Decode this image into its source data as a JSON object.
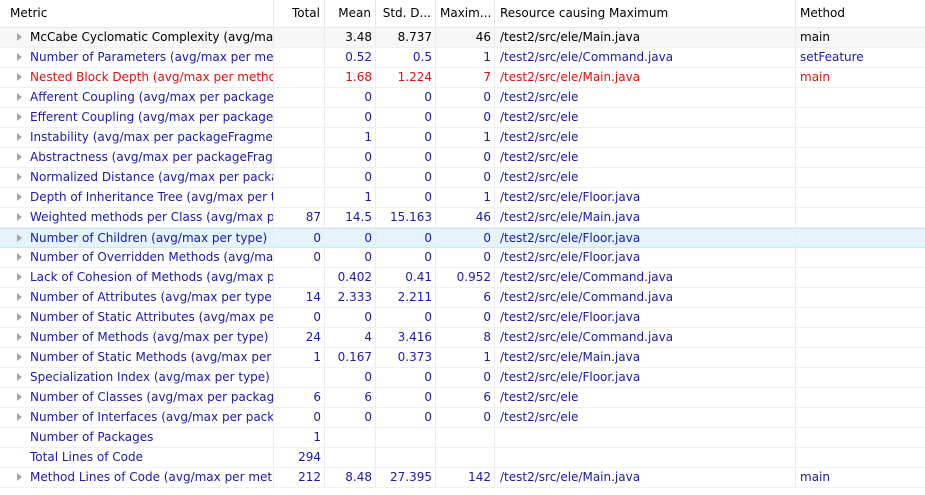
{
  "columns": [
    "Metric",
    "Total",
    "Mean",
    "Std. D...",
    "Maxim...",
    "Resource causing Maximum",
    "Method"
  ],
  "colors": {
    "normal": "#1a1aa6",
    "warning": "#e01010",
    "default": "#000000"
  },
  "rows": [
    {
      "metric": "McCabe Cyclomatic Complexity (avg/max",
      "total": "",
      "mean": "3.48",
      "std": "8.737",
      "max": "46",
      "resource": "/test2/src/ele/Main.java",
      "method": "main",
      "style": "black",
      "arrow": true
    },
    {
      "metric": "Number of Parameters (avg/max per meth",
      "total": "",
      "mean": "0.52",
      "std": "0.5",
      "max": "1",
      "resource": "/test2/src/ele/Command.java",
      "method": "setFeature",
      "style": "blue",
      "arrow": true
    },
    {
      "metric": "Nested Block Depth (avg/max per methoc",
      "total": "",
      "mean": "1.68",
      "std": "1.224",
      "max": "7",
      "resource": "/test2/src/ele/Main.java",
      "method": "main",
      "style": "red",
      "arrow": true
    },
    {
      "metric": "Afferent Coupling (avg/max per packageF",
      "total": "",
      "mean": "0",
      "std": "0",
      "max": "0",
      "resource": "/test2/src/ele",
      "method": "",
      "style": "blue",
      "arrow": true
    },
    {
      "metric": "Efferent Coupling (avg/max per packageFı",
      "total": "",
      "mean": "0",
      "std": "0",
      "max": "0",
      "resource": "/test2/src/ele",
      "method": "",
      "style": "blue",
      "arrow": true
    },
    {
      "metric": "Instability (avg/max per packageFragment",
      "total": "",
      "mean": "1",
      "std": "0",
      "max": "1",
      "resource": "/test2/src/ele",
      "method": "",
      "style": "blue",
      "arrow": true
    },
    {
      "metric": "Abstractness (avg/max per packageFragm",
      "total": "",
      "mean": "0",
      "std": "0",
      "max": "0",
      "resource": "/test2/src/ele",
      "method": "",
      "style": "blue",
      "arrow": true
    },
    {
      "metric": "Normalized Distance (avg/max per packag",
      "total": "",
      "mean": "0",
      "std": "0",
      "max": "0",
      "resource": "/test2/src/ele",
      "method": "",
      "style": "blue",
      "arrow": true
    },
    {
      "metric": "Depth of Inheritance Tree (avg/max per ty",
      "total": "",
      "mean": "1",
      "std": "0",
      "max": "1",
      "resource": "/test2/src/ele/Floor.java",
      "method": "",
      "style": "blue",
      "arrow": true
    },
    {
      "metric": "Weighted methods per Class (avg/max pe",
      "total": "87",
      "mean": "14.5",
      "std": "15.163",
      "max": "46",
      "resource": "/test2/src/ele/Main.java",
      "method": "",
      "style": "blue",
      "arrow": true
    },
    {
      "metric": "Number of Children (avg/max per type)",
      "total": "0",
      "mean": "0",
      "std": "0",
      "max": "0",
      "resource": "/test2/src/ele/Floor.java",
      "method": "",
      "style": "blue",
      "arrow": true,
      "selected": true
    },
    {
      "metric": "Number of Overridden Methods (avg/max",
      "total": "0",
      "mean": "0",
      "std": "0",
      "max": "0",
      "resource": "/test2/src/ele/Floor.java",
      "method": "",
      "style": "blue",
      "arrow": true
    },
    {
      "metric": "Lack of Cohesion of Methods (avg/max pe",
      "total": "",
      "mean": "0.402",
      "std": "0.41",
      "max": "0.952",
      "resource": "/test2/src/ele/Command.java",
      "method": "",
      "style": "blue",
      "arrow": true
    },
    {
      "metric": "Number of Attributes (avg/max per type)",
      "total": "14",
      "mean": "2.333",
      "std": "2.211",
      "max": "6",
      "resource": "/test2/src/ele/Command.java",
      "method": "",
      "style": "blue",
      "arrow": true
    },
    {
      "metric": "Number of Static Attributes (avg/max per",
      "total": "0",
      "mean": "0",
      "std": "0",
      "max": "0",
      "resource": "/test2/src/ele/Floor.java",
      "method": "",
      "style": "blue",
      "arrow": true
    },
    {
      "metric": "Number of Methods (avg/max per type)",
      "total": "24",
      "mean": "4",
      "std": "3.416",
      "max": "8",
      "resource": "/test2/src/ele/Command.java",
      "method": "",
      "style": "blue",
      "arrow": true
    },
    {
      "metric": "Number of Static Methods (avg/max per t",
      "total": "1",
      "mean": "0.167",
      "std": "0.373",
      "max": "1",
      "resource": "/test2/src/ele/Main.java",
      "method": "",
      "style": "blue",
      "arrow": true
    },
    {
      "metric": "Specialization Index (avg/max per type)",
      "total": "",
      "mean": "0",
      "std": "0",
      "max": "0",
      "resource": "/test2/src/ele/Floor.java",
      "method": "",
      "style": "blue",
      "arrow": true
    },
    {
      "metric": "Number of Classes (avg/max per package",
      "total": "6",
      "mean": "6",
      "std": "0",
      "max": "6",
      "resource": "/test2/src/ele",
      "method": "",
      "style": "blue",
      "arrow": true
    },
    {
      "metric": "Number of Interfaces (avg/max per packa",
      "total": "0",
      "mean": "0",
      "std": "0",
      "max": "0",
      "resource": "/test2/src/ele",
      "method": "",
      "style": "blue",
      "arrow": true
    },
    {
      "metric": "Number of Packages",
      "total": "1",
      "mean": "",
      "std": "",
      "max": "",
      "resource": "",
      "method": "",
      "style": "blue",
      "arrow": false
    },
    {
      "metric": "Total Lines of Code",
      "total": "294",
      "mean": "",
      "std": "",
      "max": "",
      "resource": "",
      "method": "",
      "style": "blue",
      "arrow": false
    },
    {
      "metric": "Method Lines of Code (avg/max per meth",
      "total": "212",
      "mean": "8.48",
      "std": "27.395",
      "max": "142",
      "resource": "/test2/src/ele/Main.java",
      "method": "main",
      "style": "blue",
      "arrow": true
    }
  ]
}
